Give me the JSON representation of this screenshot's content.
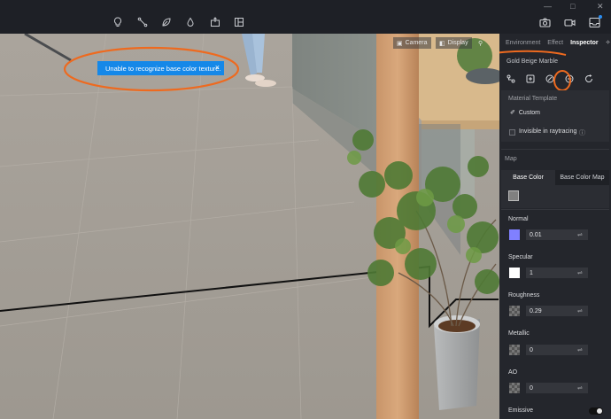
{
  "toolbar": {
    "icons": [
      "lightbulb-icon",
      "path-icon",
      "leaf-icon",
      "drop-icon",
      "export-icon",
      "layout-icon"
    ],
    "right_icons": [
      "camera-icon",
      "video-icon",
      "inbox-icon"
    ]
  },
  "viewport": {
    "toast_message": "Unable to recognize base color texture.",
    "toast_close": "×",
    "camera_button": "Camera",
    "display_button": "Display"
  },
  "panel": {
    "tabs": {
      "environment": "Environment",
      "effect": "Effect",
      "inspector": "Inspector"
    },
    "material_name": "Gold Beige Marble",
    "material_template_label": "Material Template",
    "material_template_value": "Custom",
    "invisible_label": "Invisible in raytracing",
    "map_label": "Map",
    "base_color_tab": "Base Color",
    "base_color_map_tab": "Base Color Map",
    "normal": {
      "label": "Normal",
      "value": "0.01"
    },
    "specular": {
      "label": "Specular",
      "value": "1"
    },
    "roughness": {
      "label": "Roughness",
      "value": "0.29"
    },
    "metallic": {
      "label": "Metallic",
      "value": "0"
    },
    "ao": {
      "label": "AO",
      "value": "0"
    },
    "emissive_label": "Emissive"
  },
  "colors": {
    "accent": "#1588e8",
    "annotation": "#ee6a1f",
    "base_color_swatch": "#808080",
    "normal_swatch": "#8080ff",
    "specular_swatch": "#ffffff"
  }
}
